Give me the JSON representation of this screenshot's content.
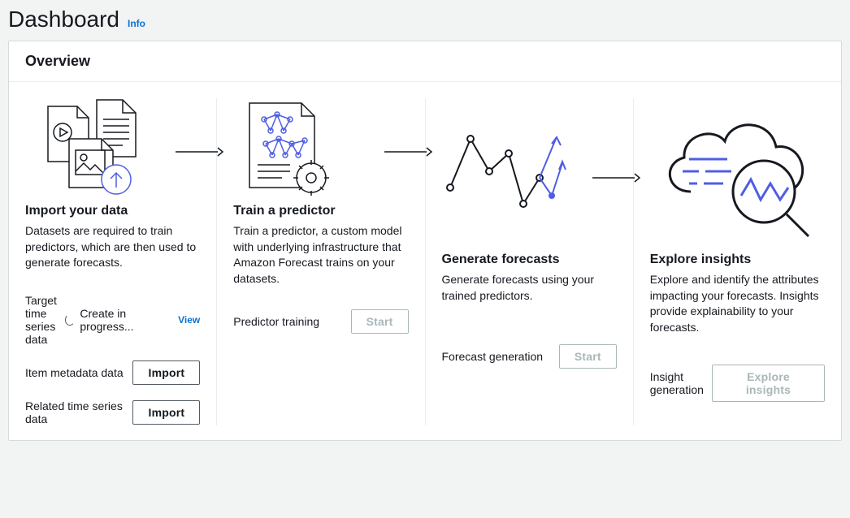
{
  "header": {
    "title": "Dashboard",
    "info": "Info"
  },
  "panel": {
    "title": "Overview"
  },
  "steps": {
    "import": {
      "title": "Import your data",
      "desc": "Datasets are required to train predictors, which are then used to generate forecasts.",
      "target_label": "Target time series data",
      "target_status": "Create in progress...",
      "target_view": "View",
      "item_label": "Item metadata data",
      "item_btn": "Import",
      "related_label": "Related time series data",
      "related_btn": "Import"
    },
    "train": {
      "title": "Train a predictor",
      "desc": "Train a predictor, a custom model with underlying infrastructure that Amazon Forecast trains on your datasets.",
      "pred_label": "Predictor training",
      "pred_btn": "Start"
    },
    "forecast": {
      "title": "Generate forecasts",
      "desc": "Generate forecasts using your trained predictors.",
      "gen_label": "Forecast generation",
      "gen_btn": "Start"
    },
    "insights": {
      "title": "Explore insights",
      "desc": "Explore and identify the attributes impacting your forecasts. Insights provide explainability to your forecasts.",
      "gen_label": "Insight generation",
      "gen_btn": "Explore insights"
    }
  }
}
